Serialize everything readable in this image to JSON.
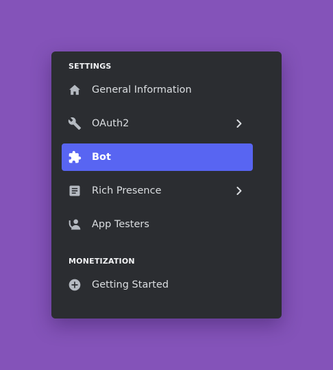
{
  "colors": {
    "background": "#8453b9",
    "panel": "#2b2d31",
    "active_item": "#5865f2",
    "icon": "#b5bac1",
    "text": "#dbdee1",
    "header_text": "#f2f3f5"
  },
  "sections": {
    "settings": {
      "header": "SETTINGS",
      "items": [
        {
          "label": "General Information",
          "icon": "home-icon",
          "has_chevron": false,
          "active": false
        },
        {
          "label": "OAuth2",
          "icon": "wrench-icon",
          "has_chevron": true,
          "active": false
        },
        {
          "label": "Bot",
          "icon": "puzzle-piece-icon",
          "has_chevron": false,
          "active": true
        },
        {
          "label": "Rich Presence",
          "icon": "document-icon",
          "has_chevron": true,
          "active": false
        },
        {
          "label": "App Testers",
          "icon": "user-testers-icon",
          "has_chevron": false,
          "active": false
        }
      ]
    },
    "monetization": {
      "header": "MONETIZATION",
      "items": [
        {
          "label": "Getting Started",
          "icon": "plus-circle-icon",
          "has_chevron": false,
          "active": false
        }
      ]
    }
  }
}
